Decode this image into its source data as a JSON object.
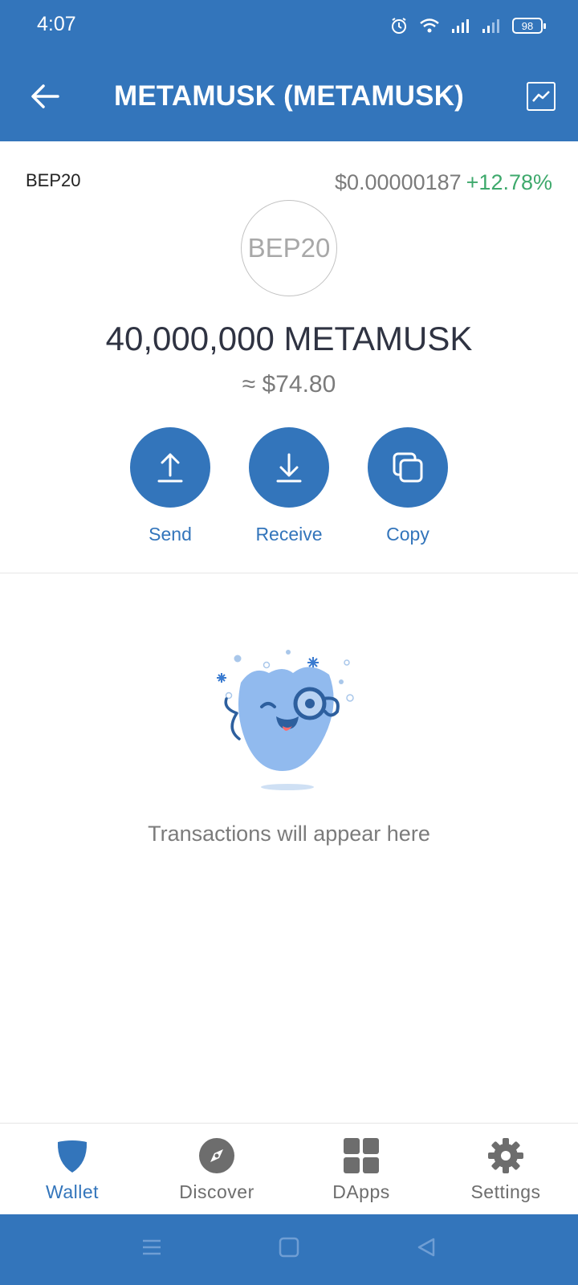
{
  "status_bar": {
    "time": "4:07",
    "battery": "98",
    "icons": [
      "alarm-icon",
      "wifi-icon",
      "signal-icon",
      "signal-icon",
      "battery-icon"
    ]
  },
  "header": {
    "title": "METAMUSK (METAMUSK)",
    "back_icon": "arrow-left-icon",
    "chart_icon": "chart-icon"
  },
  "token": {
    "network": "BEP20",
    "price": "$0.00000187",
    "change": "+12.78%",
    "logo_text": "BEP20",
    "balance": "40,000,000 METAMUSK",
    "fiat_value": "≈ $74.80"
  },
  "actions": [
    {
      "label": "Send",
      "icon": "upload-icon"
    },
    {
      "label": "Receive",
      "icon": "download-icon"
    },
    {
      "label": "Copy",
      "icon": "copy-icon"
    }
  ],
  "empty_state": {
    "message": "Transactions will appear here"
  },
  "bottom_nav": [
    {
      "label": "Wallet",
      "icon": "shield-icon",
      "active": true
    },
    {
      "label": "Discover",
      "icon": "compass-icon",
      "active": false
    },
    {
      "label": "DApps",
      "icon": "grid-icon",
      "active": false
    },
    {
      "label": "Settings",
      "icon": "gear-icon",
      "active": false
    }
  ],
  "colors": {
    "brand": "#3375bb",
    "positive": "#3ea96c",
    "muted_text": "#7b7b7b"
  }
}
